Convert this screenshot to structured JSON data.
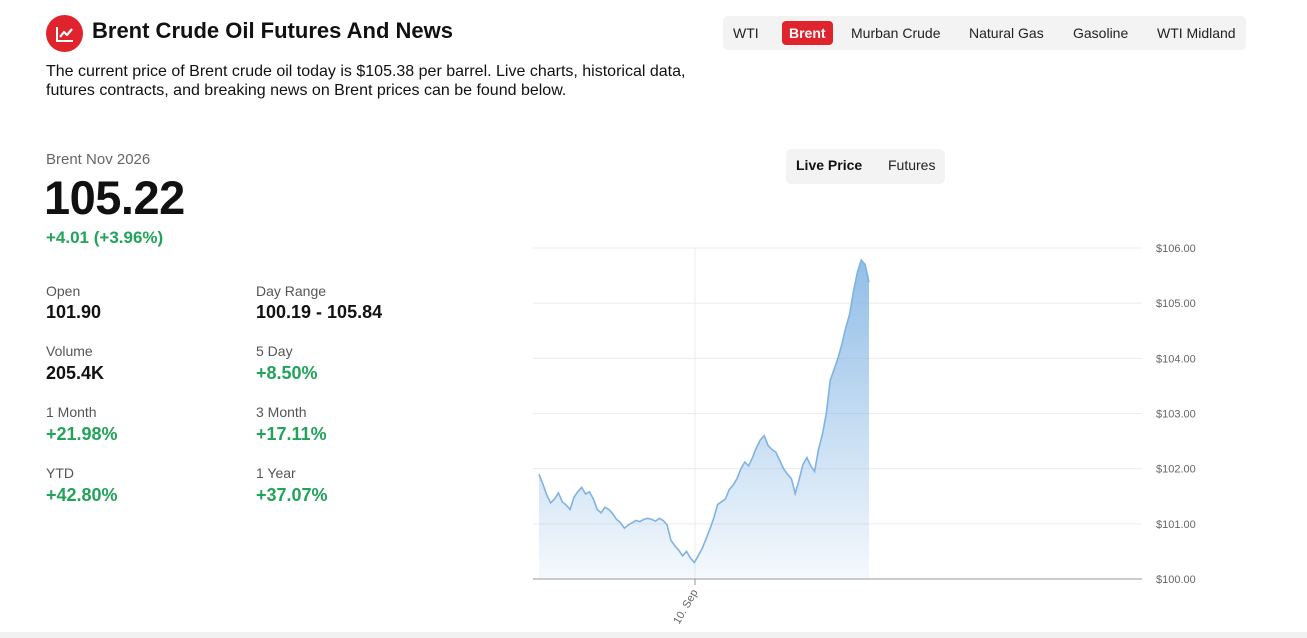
{
  "header": {
    "title": "Brent Crude Oil Futures And News",
    "intro": "The current price of Brent crude oil today is $105.38 per barrel. Live charts, historical data, futures contracts, and breaking news on Brent prices can be found below.",
    "logo_icon": "line-chart-icon",
    "brand_color": "#e0242e"
  },
  "tabs": [
    {
      "label": "WTI",
      "active": false
    },
    {
      "label": "Brent",
      "active": true
    },
    {
      "label": "Murban Crude",
      "active": false
    },
    {
      "label": "Natural Gas",
      "active": false
    },
    {
      "label": "Gasoline",
      "active": false
    },
    {
      "label": "WTI Midland",
      "active": false
    }
  ],
  "quote": {
    "contract": "Brent Nov 2026",
    "price": "105.22",
    "change": "+4.01 (+3.96%)",
    "positive_color": "#22a35a"
  },
  "stats": [
    {
      "label": "Open",
      "value": "101.90",
      "positive": false
    },
    {
      "label": "Day Range",
      "value": "100.19 - 105.84",
      "positive": false
    },
    {
      "label": "Volume",
      "value": "205.4K",
      "positive": false
    },
    {
      "label": "5 Day",
      "value": "+8.50%",
      "positive": true
    },
    {
      "label": "1 Month",
      "value": "+21.98%",
      "positive": true
    },
    {
      "label": "3 Month",
      "value": "+17.11%",
      "positive": true
    },
    {
      "label": "YTD",
      "value": "+42.80%",
      "positive": true
    },
    {
      "label": "1 Year",
      "value": "+37.07%",
      "positive": true
    }
  ],
  "chart_toggle": {
    "live_label": "Live Price",
    "futures_label": "Futures"
  },
  "chart_data": {
    "type": "area",
    "y_tick_labels": [
      "$100.00",
      "$101.00",
      "$102.00",
      "$103.00",
      "$104.00",
      "$105.00",
      "$106.00"
    ],
    "y_ticks": [
      100,
      101,
      102,
      103,
      104,
      105,
      106
    ],
    "ylim": [
      100,
      106
    ],
    "x_tick_labels": [
      "10. Sep"
    ],
    "grid": true,
    "line_color": "#7fb3e3",
    "series": [
      {
        "values": [
          101.9,
          101.72,
          101.52,
          101.38,
          101.45,
          101.56,
          101.4,
          101.34,
          101.26,
          101.48,
          101.58,
          101.66,
          101.54,
          101.58,
          101.45,
          101.26,
          101.2,
          101.3,
          101.26,
          101.18,
          101.08,
          101.02,
          100.92,
          100.98,
          101.02,
          101.06,
          101.04,
          101.08,
          101.1,
          101.08,
          101.05,
          101.1,
          101.06,
          100.98,
          100.7,
          100.6,
          100.52,
          100.42,
          100.5,
          100.38,
          100.3,
          100.42,
          100.55,
          100.72,
          100.9,
          101.1,
          101.35,
          101.4,
          101.45,
          101.62,
          101.7,
          101.82,
          102.0,
          102.12,
          102.05,
          102.2,
          102.38,
          102.52,
          102.6,
          102.42,
          102.35,
          102.3,
          102.15,
          102.0,
          101.9,
          101.82,
          101.55,
          101.8,
          102.08,
          102.2,
          102.05,
          101.95,
          102.35,
          102.62,
          103.0,
          103.6,
          103.8,
          104.0,
          104.25,
          104.55,
          104.8,
          105.22,
          105.56,
          105.78,
          105.7,
          105.38
        ]
      }
    ]
  }
}
